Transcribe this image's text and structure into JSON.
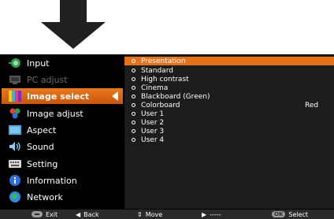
{
  "menu": {
    "items": [
      {
        "label": "Input",
        "icon": "input-icon",
        "disabled": false
      },
      {
        "label": "PC adjust",
        "icon": "pc-adjust-icon",
        "disabled": true
      },
      {
        "label": "Image select",
        "icon": "image-select-icon",
        "disabled": false,
        "selected": true
      },
      {
        "label": "Image adjust",
        "icon": "image-adjust-icon",
        "disabled": false
      },
      {
        "label": "Aspect",
        "icon": "aspect-icon",
        "disabled": false
      },
      {
        "label": "Sound",
        "icon": "sound-icon",
        "disabled": false
      },
      {
        "label": "Setting",
        "icon": "setting-icon",
        "disabled": false
      },
      {
        "label": "Information",
        "icon": "information-icon",
        "disabled": false
      },
      {
        "label": "Network",
        "icon": "network-icon",
        "disabled": false
      }
    ]
  },
  "submenu": {
    "items": [
      {
        "label": "Presentation",
        "selected": true
      },
      {
        "label": "Standard"
      },
      {
        "label": "High contrast"
      },
      {
        "label": "Cinema"
      },
      {
        "label": "Blackboard (Green)"
      },
      {
        "label": "Colorboard",
        "value": "Red"
      },
      {
        "label": "User 1"
      },
      {
        "label": "User 2"
      },
      {
        "label": "User 3"
      },
      {
        "label": "User 4"
      }
    ]
  },
  "footer": {
    "exit": "Exit",
    "back": "Back",
    "move": "Move",
    "next": "-----",
    "ok_badge": "OK",
    "select": "Select"
  },
  "colors": {
    "accent": "#e7711b",
    "background": "#000000",
    "panel": "#1c1c1c"
  }
}
